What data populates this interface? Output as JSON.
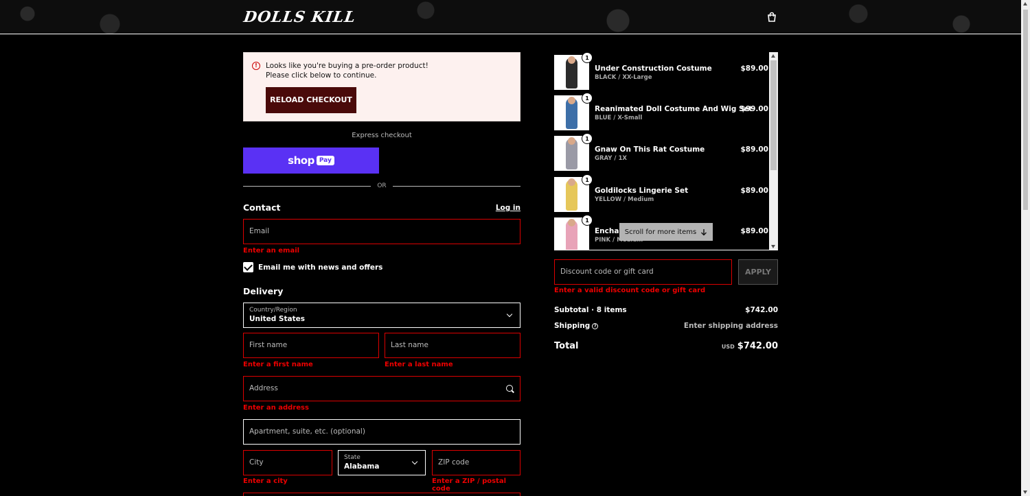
{
  "header": {
    "logo": "DOLLS KILL",
    "cart_icon": "shopping-bag-icon"
  },
  "alert": {
    "line1": "Looks like you're buying a pre-order product!",
    "line2": "Please click below to continue.",
    "button": "RELOAD CHECKOUT",
    "icon": "alert-circle-icon"
  },
  "express": {
    "label": "Express checkout",
    "shop": "shop",
    "pay": "Pay",
    "or": "OR"
  },
  "contact": {
    "title": "Contact",
    "login": "Log in",
    "email_placeholder": "Email",
    "email_error": "Enter an email",
    "newsletter_label": "Email me with news and offers",
    "newsletter_checked": true
  },
  "delivery": {
    "title": "Delivery",
    "country_label": "Country/Region",
    "country_value": "United States",
    "first_name": "First name",
    "first_name_error": "Enter a first name",
    "last_name": "Last name",
    "last_name_error": "Enter a last name",
    "address": "Address",
    "address_error": "Enter an address",
    "apartment": "Apartment, suite, etc. (optional)",
    "city": "City",
    "city_error": "Enter a city",
    "state_label": "State",
    "state_value": "Alabama",
    "zip": "ZIP code",
    "zip_error": "Enter a ZIP / postal code"
  },
  "cart": {
    "items": [
      {
        "name": "Under Construction Costume",
        "variant": "BLACK / XX-Large",
        "price": "$89.00",
        "qty": "1",
        "color": "#2b2b2b"
      },
      {
        "name": "Reanimated Doll Costume And Wig Set",
        "variant": "BLUE / X-Small",
        "price": "$99.00",
        "qty": "1",
        "color": "#3d6fa8"
      },
      {
        "name": "Gnaw On This Rat Costume",
        "variant": "GRAY / 1X",
        "price": "$89.00",
        "qty": "1",
        "color": "#9a9aa6"
      },
      {
        "name": "Goldilocks Lingerie Set",
        "variant": "YELLOW / Medium",
        "price": "$89.00",
        "qty": "1",
        "color": "#e6c75a"
      },
      {
        "name": "Enchan",
        "variant": "PINK / Medium",
        "price": "$89.00",
        "qty": "1",
        "color": "#e8a3b8"
      }
    ],
    "scroll_hint": "Scroll for more items"
  },
  "discount": {
    "placeholder": "Discount code or gift card",
    "apply": "APPLY",
    "error": "Enter a valid discount code or gift card"
  },
  "summary": {
    "subtotal_label": "Subtotal · 8 items",
    "subtotal_value": "$742.00",
    "shipping_label": "Shipping",
    "shipping_value": "Enter shipping address",
    "total_label": "Total",
    "currency": "USD",
    "total_value": "$742.00"
  }
}
